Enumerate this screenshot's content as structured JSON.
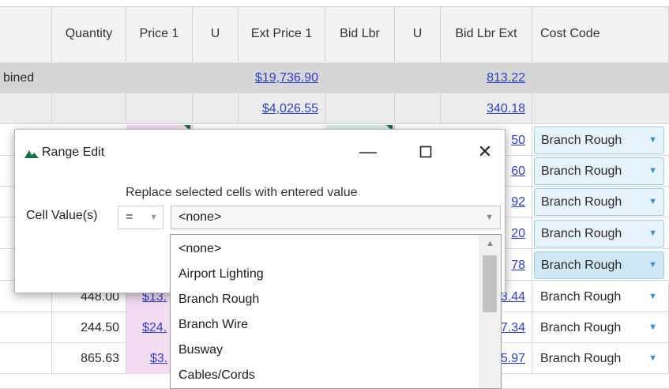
{
  "grid": {
    "headers": {
      "quantity": "Quantity",
      "price1": "Price 1",
      "u1": "U",
      "ext_price1": "Ext Price 1",
      "bid_lbr": "Bid Lbr",
      "u2": "U",
      "bid_lbr_ext": "Bid Lbr Ext",
      "cost_code": "Cost Code"
    },
    "combined_row": {
      "label": "bined",
      "ext_price1": "$19,736.90",
      "bid_lbr_ext": "813.22"
    },
    "subtotal_row": {
      "ext_price1": "$4,026.55",
      "bid_lbr_ext": "340.18"
    },
    "rows": [
      {
        "bid_lbr_ext_tail": "50",
        "cost_code": "Branch Rough"
      },
      {
        "bid_lbr_ext_tail": "60",
        "cost_code": "Branch Rough"
      },
      {
        "bid_lbr_ext_tail": "92",
        "cost_code": "Branch Rough"
      },
      {
        "bid_lbr_ext_tail": "20",
        "cost_code": "Branch Rough"
      },
      {
        "bid_lbr_ext_tail": "78",
        "cost_code": "Branch Rough"
      },
      {
        "quantity": "448.00",
        "price1_tail": "$13.",
        "bid_lbr_ext_tail": "3.44",
        "cost_code": "Branch Rough"
      },
      {
        "quantity": "244.50",
        "price1_tail": "$24.",
        "bid_lbr_ext_tail": "7.34",
        "cost_code": "Branch Rough"
      },
      {
        "quantity": "865.63",
        "price1_tail": "$3.",
        "bid_lbr_ext_tail": "5.97",
        "cost_code": "Branch Rough"
      }
    ]
  },
  "dialog": {
    "title": "Range Edit",
    "hint": "Replace selected cells with entered value",
    "cell_value_label": "Cell Value(s)",
    "operator": "=",
    "value": "<none>",
    "options": [
      "<none>",
      "Airport Lighting",
      "Branch Rough",
      "Branch Wire",
      "Busway",
      "Cables/Cords"
    ]
  },
  "colors": {
    "link": "#2b3fc8",
    "accent_green": "#1a6e4a",
    "dropdown_bg": "#e7f3fb"
  }
}
